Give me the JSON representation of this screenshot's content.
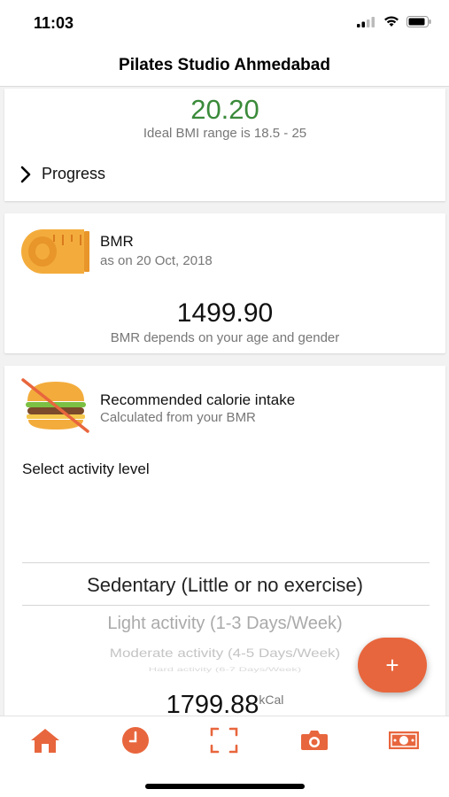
{
  "status_bar": {
    "time": "11:03"
  },
  "header": {
    "title": "Pilates Studio Ahmedabad"
  },
  "bmi_card": {
    "value": "20.20",
    "range_text": "Ideal BMI range is 18.5 - 25",
    "progress_label": "Progress"
  },
  "bmr_card": {
    "title": "BMR",
    "date_text": "as on 20 Oct, 2018",
    "value": "1499.90",
    "note": "BMR depends on your age and gender"
  },
  "calorie_card": {
    "title": "Recommended calorie intake",
    "subtitle": "Calculated from your BMR",
    "activity_label": "Select activity level",
    "options": [
      "Sedentary (Little or no exercise)",
      "Light activity (1-3 Days/Week)",
      "Moderate activity (4-5 Days/Week)",
      "Hard activity (6-7 Days/Week)"
    ],
    "value": "1799.88",
    "unit": "kCal"
  },
  "fab": {
    "label": "+"
  },
  "tabs": [
    {
      "name": "home",
      "icon": "home-icon"
    },
    {
      "name": "clock",
      "icon": "clock-icon"
    },
    {
      "name": "scan",
      "icon": "scan-icon"
    },
    {
      "name": "camera",
      "icon": "camera-icon"
    },
    {
      "name": "payment",
      "icon": "money-icon"
    }
  ],
  "colors": {
    "accent": "#e8663d",
    "bmi_value": "#3a8a3a",
    "muted_text": "#777777"
  }
}
